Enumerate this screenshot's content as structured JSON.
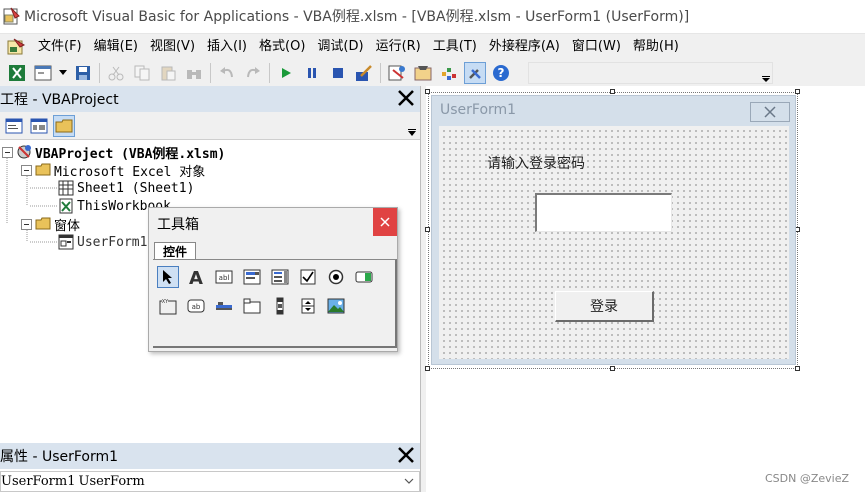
{
  "window": {
    "title": "Microsoft Visual Basic for Applications - VBA例程.xlsm - [VBA例程.xlsm - UserForm1 (UserForm)]"
  },
  "menu": {
    "items": [
      "文件(F)",
      "编辑(E)",
      "视图(V)",
      "插入(I)",
      "格式(O)",
      "调试(D)",
      "运行(R)",
      "工具(T)",
      "外接程序(A)",
      "窗口(W)",
      "帮助(H)"
    ]
  },
  "toolbar": {
    "icons": [
      "excel-icon",
      "insert-userform-icon",
      "save-icon",
      "cut-icon",
      "copy-icon",
      "paste-icon",
      "find-icon",
      "undo-icon",
      "redo-icon",
      "run-icon",
      "break-icon",
      "reset-icon",
      "design-mode-icon",
      "project-explorer-icon",
      "properties-icon",
      "object-browser-icon",
      "toolbox-icon",
      "help-icon"
    ]
  },
  "project_pane": {
    "title": "工程 - VBAProject",
    "tree": [
      {
        "label": "VBAProject (VBA例程.xlsm)",
        "level": 0,
        "icon": "vbaproject-icon"
      },
      {
        "label": "Microsoft Excel 对象",
        "level": 1,
        "icon": "folder-icon"
      },
      {
        "label": "Sheet1 (Sheet1)",
        "level": 2,
        "icon": "sheet-icon"
      },
      {
        "label": "ThisWorkbook",
        "level": 2,
        "icon": "workbook-icon"
      },
      {
        "label": "窗体",
        "level": 1,
        "icon": "folder-icon"
      },
      {
        "label": "UserForm1",
        "level": 2,
        "icon": "userform-icon"
      }
    ]
  },
  "properties_pane": {
    "title": "属性 - UserForm1",
    "object_name": "UserForm1",
    "object_type": "UserForm"
  },
  "toolbox": {
    "title": "工具箱",
    "tab": "控件",
    "controls_row1": [
      "select-objects-icon",
      "label-icon",
      "textbox-icon",
      "combobox-icon",
      "listbox-icon",
      "checkbox-icon",
      "optionbutton-icon",
      "togglebutton-icon"
    ],
    "controls_row2": [
      "frame-icon",
      "commandbutton-icon",
      "tabstrip-icon",
      "multipage-icon",
      "scrollbar-icon",
      "spinbutton-icon",
      "image-icon"
    ]
  },
  "userform": {
    "caption": "UserForm1",
    "prompt_label": "请输入登录密码",
    "textbox_value": "",
    "login_button": "登录"
  },
  "watermark": "CSDN @ZevieZ"
}
